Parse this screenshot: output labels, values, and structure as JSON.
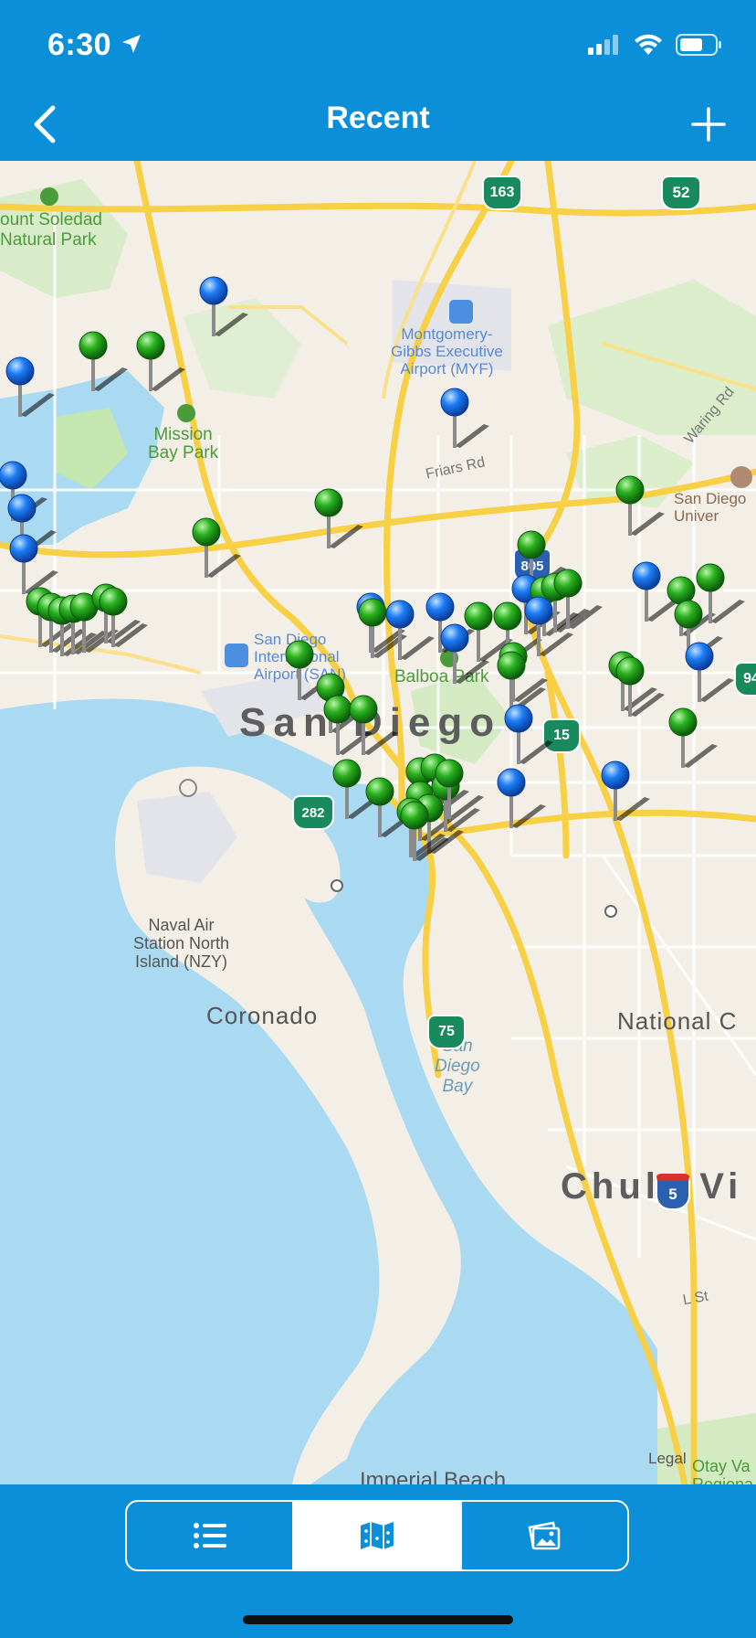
{
  "status_bar": {
    "time": "6:30",
    "location_icon": "location-arrow-icon",
    "signal_icon": "cellular-signal-icon",
    "wifi_icon": "wifi-icon",
    "battery_icon": "battery-icon"
  },
  "nav": {
    "title": "Recent",
    "back_icon": "chevron-left-icon",
    "add_icon": "plus-icon"
  },
  "colors": {
    "bar": "#0a8fd8",
    "pin_green": "#1fa81f",
    "pin_blue": "#1677f2",
    "water": "#aadaf2",
    "land": "#f3efe6",
    "highway": "#f7d046"
  },
  "map": {
    "labels": {
      "mount_soledad": "ount Soledad",
      "natural_park": "Natural Park",
      "montgomery_1": "Montgomery-",
      "montgomery_2": "Gibbs Executive",
      "montgomery_3": "Airport (MYF)",
      "mission_bay_1": "Mission",
      "mission_bay_2": "Bay Park",
      "friars_rd": "Friars Rd",
      "waring_rd": "Waring Rd",
      "san_diego_univ_1": "San Diego",
      "san_diego_univ_2": "Univer",
      "airport_1": "San Diego",
      "airport_2": "International",
      "airport_3": "Airport (SAN)",
      "balboa_park": "Balboa Park",
      "san_diego": "San Diego",
      "naval_air_1": "Naval Air",
      "naval_air_2": "Station North",
      "naval_air_3": "Island (NZY)",
      "coronado": "Coronado",
      "national_city": "National C",
      "bay_1": "San",
      "bay_2": "Diego",
      "bay_3": "Bay",
      "chula_vista": "Chula Vi",
      "l_st": "L St",
      "legal": "Legal",
      "otay_1": "Otay Va",
      "otay_2": "Regiona",
      "imperial_beach": "Imperial Beach"
    },
    "shields": {
      "r163": "163",
      "r52": "52",
      "r805": "805",
      "r15": "15",
      "r282": "282",
      "r75": "75",
      "i5": "5",
      "r94": "94"
    }
  },
  "tabs": {
    "list_icon": "list-icon",
    "map_icon": "map-icon",
    "photos_icon": "photos-icon",
    "active": "map"
  }
}
